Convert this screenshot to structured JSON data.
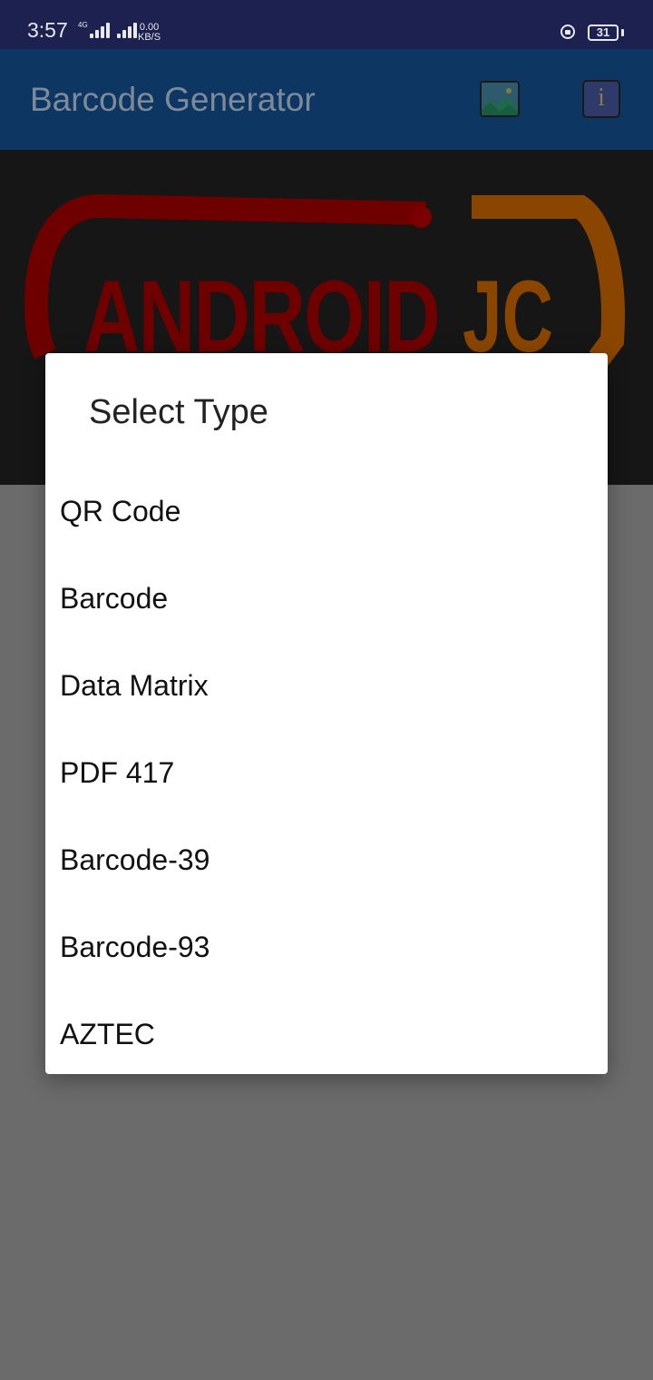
{
  "status_bar": {
    "time": "3:57",
    "network": "4G",
    "speed_value": "0.00",
    "speed_unit": "KB/S",
    "battery": "31"
  },
  "app_bar": {
    "title": "Barcode Generator",
    "gallery_icon": "image-icon",
    "info_icon": "info-icon"
  },
  "banner": {
    "text_left": "ANDROID",
    "text_right": "JC"
  },
  "dialog": {
    "title": "Select Type",
    "options": [
      {
        "label": "QR Code"
      },
      {
        "label": "Barcode"
      },
      {
        "label": "Data Matrix"
      },
      {
        "label": "PDF 417"
      },
      {
        "label": "Barcode-39"
      },
      {
        "label": "Barcode-93"
      },
      {
        "label": "AZTEC"
      }
    ]
  },
  "colors": {
    "status_bar": "#1c2150",
    "app_bar": "#0d3662",
    "scrim": "#6b6b6b",
    "dialog": "#ffffff",
    "logo_red": "#6e0000",
    "logo_orange": "#8a4600"
  }
}
